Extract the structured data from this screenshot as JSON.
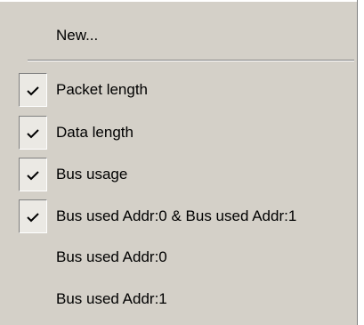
{
  "menu": {
    "new_item": {
      "label": "New..."
    },
    "items": [
      {
        "label": "Packet length",
        "checked": true
      },
      {
        "label": "Data length",
        "checked": true
      },
      {
        "label": "Bus usage",
        "checked": true
      },
      {
        "label": "Bus used Addr:0 & Bus used Addr:1",
        "checked": true
      },
      {
        "label": "Bus used Addr:0",
        "checked": false
      },
      {
        "label": "Bus used Addr:1",
        "checked": false
      }
    ],
    "check_icon": "checkmark-icon",
    "colors": {
      "menu_background": "#d4d0c8",
      "check_box_background": "#ebe9e4",
      "text": "#000000",
      "shadow": "#808080",
      "highlight": "#ffffff"
    }
  }
}
